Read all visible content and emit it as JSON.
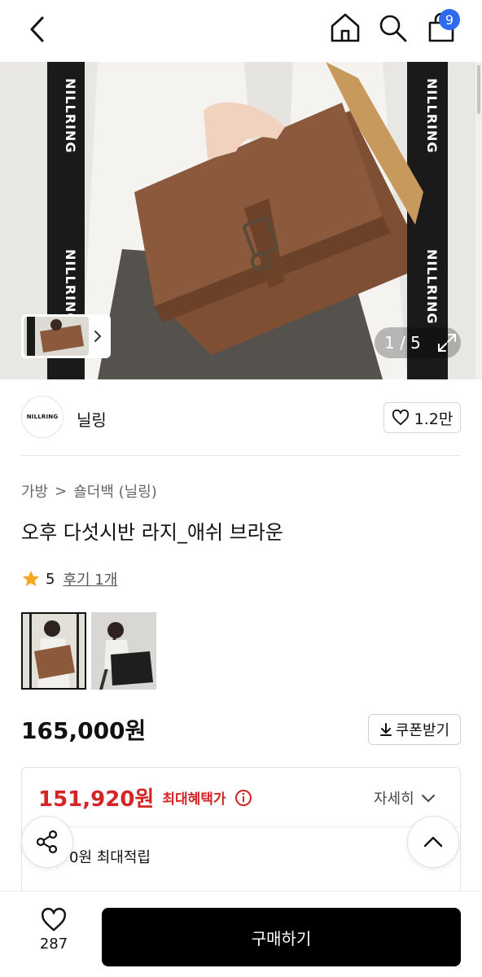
{
  "header": {
    "icons": [
      "chevron-left-icon",
      "home-icon",
      "search-icon",
      "cart-icon"
    ],
    "cart_count": "9"
  },
  "hero": {
    "strap_text": "NILLRING",
    "pager_text": "1 / 5",
    "icons": [
      "chevron-right-icon",
      "expand-icon"
    ]
  },
  "brand": {
    "logo_text": "NILLRING",
    "name": "닐링",
    "like_count": "1.2만"
  },
  "breadcrumb": {
    "category": "가방",
    "separator": ">",
    "subcategory": "숄더백 (닐링)"
  },
  "product": {
    "title": "오후 다섯시반 라지_애쉬 브라운",
    "rating": "5",
    "review_link": "후기 1개",
    "price": "165,000원"
  },
  "coupon": {
    "label": "쿠폰받기"
  },
  "benefit": {
    "best_price": "151,920원",
    "best_price_label": "최대혜택가",
    "detail_label": "자세히",
    "points_text": "0원 최대적립"
  },
  "bottom": {
    "wish_count": "287",
    "buy_label": "구매하기"
  },
  "colors": {
    "accent_red": "#d32525",
    "badge_blue": "#2f6bf2",
    "star_yellow": "#f5a623",
    "bag_brown": "#8b5a3c"
  }
}
